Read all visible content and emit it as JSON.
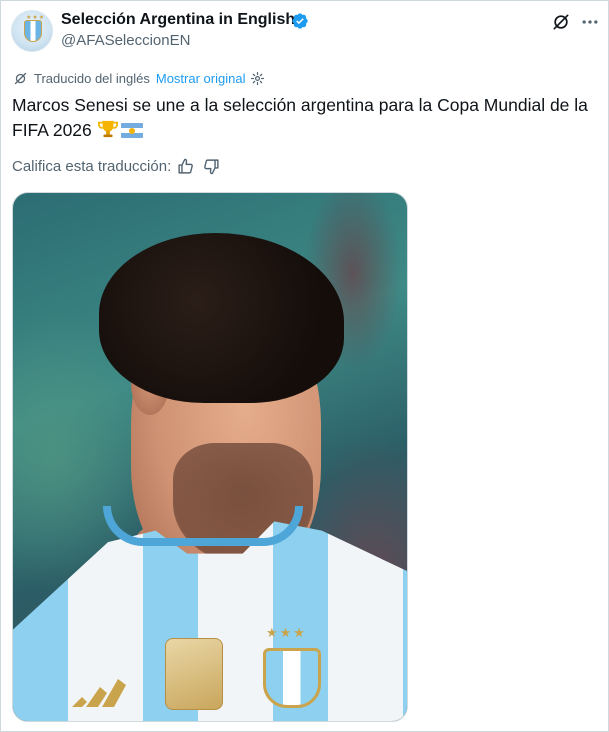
{
  "account": {
    "display_name": "Selección Argentina in English",
    "handle": "@AFASeleccionEN",
    "verified": true,
    "avatar_icon": "afa-crest-avatar"
  },
  "header_actions": {
    "grok_icon": "grok-icon",
    "more_icon": "more-icon"
  },
  "translation": {
    "translated_from": "Traducido del inglés",
    "show_original": "Mostrar original"
  },
  "tweet": {
    "text": "Marcos Senesi se une a la selección argentina para la Copa Mundial de la FIFA 2026",
    "emojis": [
      "trophy",
      "argentina-flag"
    ]
  },
  "rating": {
    "label": "Califica esta traducción:",
    "thumbs_up_icon": "thumbs-up-icon",
    "thumbs_down_icon": "thumbs-down-icon"
  },
  "media": {
    "type": "photo",
    "subject": "player-portrait"
  },
  "colors": {
    "link": "#1d9bf0",
    "secondary_text": "#536471",
    "verified": "#1d9bf0",
    "text": "#0f1419"
  }
}
